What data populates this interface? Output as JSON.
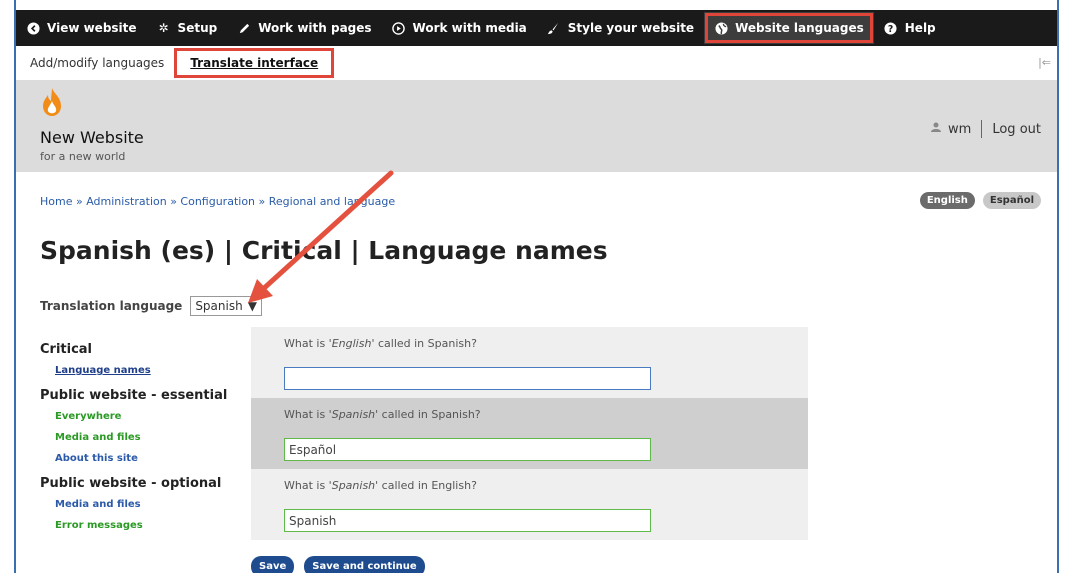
{
  "toolbar": {
    "items": [
      {
        "label": "View website",
        "icon": "chevron-left-circle-icon"
      },
      {
        "label": "Setup",
        "icon": "gear-icon"
      },
      {
        "label": "Work with pages",
        "icon": "pencil-icon"
      },
      {
        "label": "Work with media",
        "icon": "play-circle-icon"
      },
      {
        "label": "Style your website",
        "icon": "brush-icon"
      },
      {
        "label": "Website languages",
        "icon": "globe-icon"
      },
      {
        "label": "Help",
        "icon": "question-circle-icon"
      }
    ]
  },
  "tray": {
    "items": [
      {
        "label": "Add/modify languages"
      },
      {
        "label": "Translate interface"
      }
    ]
  },
  "header": {
    "site_name": "New Website",
    "slogan": "for a new world",
    "user": "wm",
    "logout": "Log out"
  },
  "breadcrumb": "Home » Administration » Configuration » Regional and language",
  "language_switcher": [
    "English",
    "Español"
  ],
  "page_title": "Spanish (es) | Critical | Language names",
  "translation_language": {
    "label": "Translation language",
    "value": "Spanish"
  },
  "sidebar": {
    "groups": [
      {
        "heading": "Critical",
        "links": [
          "Language names"
        ]
      },
      {
        "heading": "Public website - essential",
        "links": [
          "Everywhere",
          "Media and files",
          "About this site"
        ]
      },
      {
        "heading": "Public website - optional",
        "links": [
          "Media and files",
          "Error messages"
        ]
      }
    ]
  },
  "form": {
    "questions": [
      {
        "before": "What is '",
        "term": "English",
        "after": "' called in Spanish?",
        "value": ""
      },
      {
        "before": "What is '",
        "term": "Spanish",
        "after": "' called in Spanish?",
        "value": "Español"
      },
      {
        "before": "What is '",
        "term": "Spanish",
        "after": "' called in English?",
        "value": "Spanish"
      }
    ],
    "save": "Save",
    "save_continue": "Save and continue"
  },
  "colors": {
    "highlight": "#e0453a",
    "toolbar": "#1a1a1a",
    "link": "#2a5ca8",
    "green_link": "#2b9a25",
    "button": "#1f4b8f"
  }
}
